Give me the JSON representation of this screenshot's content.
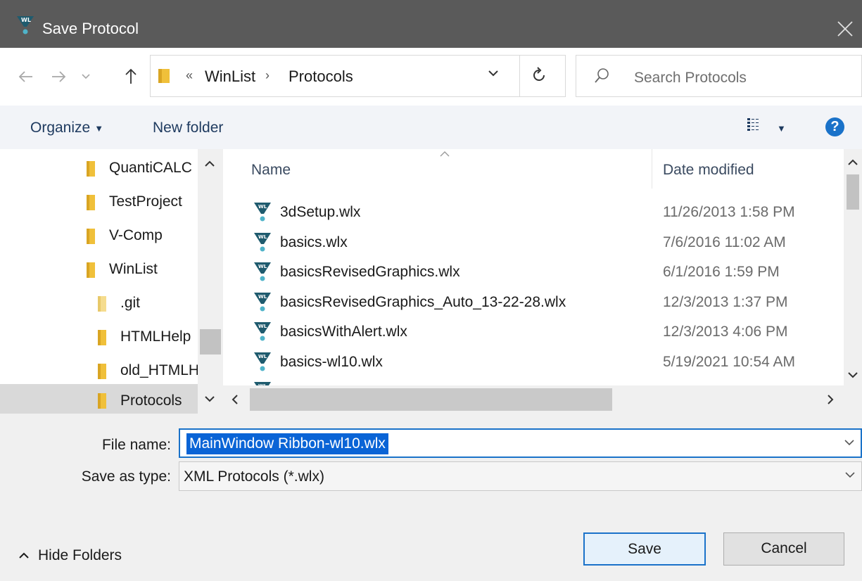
{
  "window": {
    "title": "Save Protocol"
  },
  "address": {
    "overflow_glyph": "«",
    "crumbs": [
      "WinList",
      "Protocols"
    ],
    "separator": "›"
  },
  "search": {
    "placeholder": "Search Protocols"
  },
  "toolbar": {
    "organize_label": "Organize",
    "new_folder_label": "New folder",
    "help_label": "?"
  },
  "nav_pane": {
    "items": [
      {
        "label": "QuantiCALC",
        "indent": 1
      },
      {
        "label": "TestProject",
        "indent": 1
      },
      {
        "label": "V-Comp",
        "indent": 1
      },
      {
        "label": "WinList",
        "indent": 1
      },
      {
        "label": ".git",
        "indent": 2
      },
      {
        "label": "HTMLHelp",
        "indent": 2
      },
      {
        "label": "old_HTMLHelp",
        "indent": 2
      },
      {
        "label": "Protocols",
        "indent": 2,
        "selected": true
      }
    ]
  },
  "file_list": {
    "columns": [
      "Name",
      "Date modified"
    ],
    "rows": [
      {
        "name": "3dSetup.wlx",
        "date": "11/26/2013 1:58 PM"
      },
      {
        "name": "basics.wlx",
        "date": "7/6/2016 11:02 AM"
      },
      {
        "name": "basicsRevisedGraphics.wlx",
        "date": "6/1/2016 1:59 PM"
      },
      {
        "name": "basicsRevisedGraphics_Auto_13-22-28.wlx",
        "date": "12/3/2013 1:37 PM"
      },
      {
        "name": "basicsWithAlert.wlx",
        "date": "12/3/2013 4:06 PM"
      },
      {
        "name": "basics-wl10.wlx",
        "date": "5/19/2021 10:54 AM"
      }
    ]
  },
  "form": {
    "file_name_label": "File name:",
    "file_name_value": "MainWindow Ribbon-wl10.wlx",
    "save_type_label": "Save as type:",
    "save_type_value": "XML Protocols (*.wlx)"
  },
  "footer": {
    "hide_folders_label": "Hide Folders",
    "save_label": "Save",
    "cancel_label": "Cancel"
  },
  "colors": {
    "title_bar": "#5a5a5a",
    "accent": "#1a72c9",
    "selection": "#0a64d6",
    "folder": "#f0c03a",
    "file_icon": "#1f5b6e"
  }
}
